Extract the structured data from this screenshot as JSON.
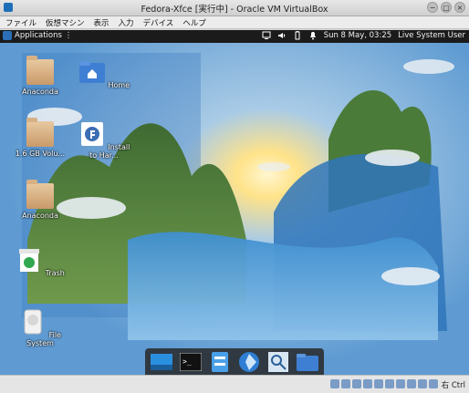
{
  "window": {
    "title": "Fedora-Xfce [実行中] - Oracle VM VirtualBox",
    "minimize_glyph": "−",
    "maximize_glyph": "▢",
    "close_glyph": "×"
  },
  "menu": [
    "ファイル",
    "仮想マシン",
    "表示",
    "入力",
    "デバイス",
    "ヘルプ"
  ],
  "panel": {
    "applications_label": "Applications ⋮",
    "clock": "Sun  8 May, 03:25",
    "user": "Live System User"
  },
  "desktop_icons": [
    {
      "label": "Anaconda"
    },
    {
      "label": "Home"
    },
    {
      "label": "1.6 GB Volu..."
    },
    {
      "label": "Install to Har..."
    },
    {
      "label": "Anaconda"
    },
    {
      "label": "Trash"
    },
    {
      "label": "File System"
    }
  ],
  "dock": [
    "show-desktop-icon",
    "terminal-icon",
    "file-manager-icon",
    "web-browser-icon",
    "app-finder-icon",
    "home-folder-icon"
  ],
  "statusbar": {
    "host_key": "右 Ctrl"
  },
  "colors": {
    "panel_bg": "#1b1b1b",
    "sky": "#6ea7d8",
    "accent_blue": "#2a7fd4"
  }
}
